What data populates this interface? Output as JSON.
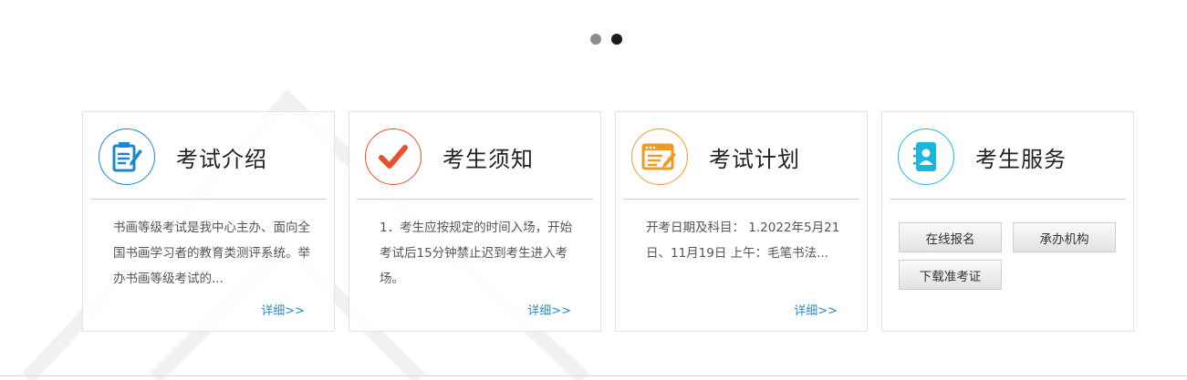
{
  "carousel": {
    "dots": [
      {
        "active": false
      },
      {
        "active": true
      }
    ]
  },
  "cards": [
    {
      "title": "考试介绍",
      "icon": "document-edit-icon",
      "color": "#1a87d6",
      "body": "书画等级考试是我中心主办、面向全国书画学习者的教育类测评系统。举办书画等级考试的...",
      "more": "详细>>"
    },
    {
      "title": "考生须知",
      "icon": "checkmark-icon",
      "color": "#e8512b",
      "body": "1．考生应按规定的时间入场，开始考试后15分钟禁止迟到考生进入考场。",
      "more": "详细>>"
    },
    {
      "title": "考试计划",
      "icon": "schedule-icon",
      "color": "#ef9a27",
      "body": "开考日期及科目：  1.2022年5月21日、11月19日 上午：毛笔书法...",
      "more": "详细>>"
    },
    {
      "title": "考生服务",
      "icon": "contacts-book-icon",
      "color": "#1cb6dc",
      "buttons": [
        "在线报名",
        "承办机构",
        "下载准考证"
      ]
    }
  ]
}
